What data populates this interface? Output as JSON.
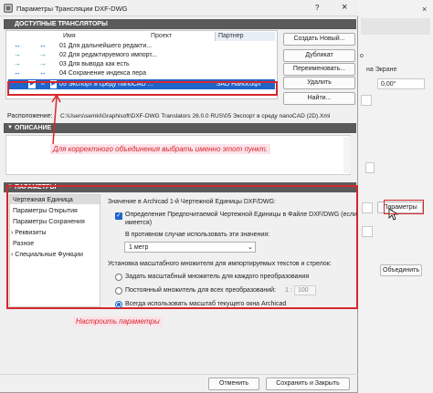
{
  "background_window": {
    "on_screen_label": "на Экране",
    "field_value_1": "0,00°",
    "parameters_button": "Параметры",
    "join_button": "Объединить",
    "letter_o": "о"
  },
  "dialog": {
    "title": "Параметры Трансляции DXF-DWG",
    "help_icon": "?",
    "close_icon": "×",
    "translators_header": "ДОСТУПНЫЕ ТРАНСЛЯТОРЫ",
    "columns": {
      "name": "Имя",
      "project": "Проект",
      "partner": "Партнер"
    },
    "translators": [
      {
        "name": "01 Для дальнейшего редакти...",
        "partner": ""
      },
      {
        "name": "02 Для редактируемого импорт...",
        "partner": ""
      },
      {
        "name": "03 Для вывода как есть",
        "partner": ""
      },
      {
        "name": "04 Сохранение индекса пера",
        "partner": ""
      },
      {
        "name": "05 Экспорт в среду nanoCAD ...",
        "partner": "ЗАО Нанософт"
      }
    ],
    "side_buttons": {
      "create_new": "Создать Новый...",
      "duplicate": "Дубликат",
      "rename": "Переименовать...",
      "delete": "Удалить",
      "find": "Найти..."
    },
    "location_label": "Расположение:",
    "location_path": "C:\\Users\\semki\\Graphisoft\\DXF-DWG Translators 26.0.0 RUS\\05 Экспорт в среду nanoCAD (2D).Xml",
    "description_header": "ОПИСАНИЕ",
    "annotation_select": "Для корректного объединения выбрать именно этот пункт.",
    "parameters_header": "ПАРАМЕТРЫ",
    "nav_items": [
      "Чертежная Единица",
      "Параметры Открытия",
      "Параметры Сохранения",
      "Реквизиты",
      "Разное",
      "Специальные Функции"
    ],
    "unit_heading": "Значение в Archicad 1-й Чертежной Единицы DXF/DWG:",
    "checkbox_label_1": "Определение Предпочитаемой Чертежной Единицы в Файле DXF/DWG (если",
    "checkbox_label_2": "имеется)",
    "otherwise_label": "В противном случае использовать эти значения:",
    "unit_select_value": "1 метр",
    "scale_heading": "Установка масштабного множителя для импортируемых текстов и стрелок:",
    "radio_options": [
      "Задать масштабный множитель для каждого преобразования",
      "Постоянный множитель для всех преобразований:",
      "Всегда использовать масштаб текущего окна Archicad"
    ],
    "ratio_left": "1 :",
    "ratio_value": "100",
    "annotation_params": "Настроить параметры",
    "cancel_button": "Отменить",
    "save_close_button": "Сохранить и Закрыть"
  }
}
